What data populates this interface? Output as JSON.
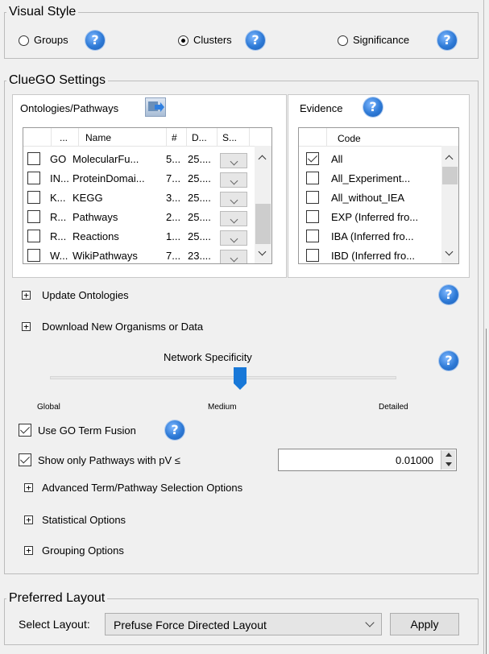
{
  "visual_style": {
    "legend": "Visual Style",
    "options": [
      {
        "label": "Groups",
        "selected": false
      },
      {
        "label": "Clusters",
        "selected": true
      },
      {
        "label": "Significance",
        "selected": false
      }
    ]
  },
  "cluego": {
    "legend": "ClueGO Settings",
    "ontologies": {
      "title": "Ontologies/Pathways",
      "columns": [
        "...",
        "Name",
        "#",
        "D...",
        "S..."
      ],
      "rows": [
        {
          "prefix": "GO",
          "name": "MolecularFu...",
          "count": "5...",
          "date": "25....",
          "checked": false
        },
        {
          "prefix": "IN...",
          "name": "ProteinDomai...",
          "count": "7...",
          "date": "25....",
          "checked": false
        },
        {
          "prefix": "K...",
          "name": "KEGG",
          "count": "3...",
          "date": "25....",
          "checked": false
        },
        {
          "prefix": "R...",
          "name": "Pathways",
          "count": "2...",
          "date": "25....",
          "checked": false
        },
        {
          "prefix": "R...",
          "name": "Reactions",
          "count": "1...",
          "date": "25....",
          "checked": false
        },
        {
          "prefix": "W...",
          "name": "WikiPathways",
          "count": "7...",
          "date": "23....",
          "checked": false
        }
      ]
    },
    "evidence": {
      "title": "Evidence",
      "column": "Code",
      "rows": [
        {
          "code": "All",
          "checked": true
        },
        {
          "code": "All_Experiment...",
          "checked": false
        },
        {
          "code": "All_without_IEA",
          "checked": false
        },
        {
          "code": "EXP (Inferred fro...",
          "checked": false
        },
        {
          "code": "IBA (Inferred fro...",
          "checked": false
        },
        {
          "code": "IBD (Inferred fro...",
          "checked": false
        }
      ]
    },
    "update_ontologies": "Update Ontologies",
    "download_new": "Download New Organisms or Data",
    "network_specificity": {
      "title": "Network Specificity",
      "labels": [
        "Global",
        "Medium",
        "Detailed"
      ],
      "selected": "Medium"
    },
    "use_go_term_fusion": {
      "label": "Use GO Term Fusion",
      "checked": true
    },
    "show_only_pathways": {
      "label": "Show only Pathways with pV ≤",
      "checked": true,
      "value": "0.01000"
    },
    "advanced_options": "Advanced Term/Pathway Selection Options",
    "statistical_options": "Statistical Options",
    "grouping_options": "Grouping Options"
  },
  "preferred_layout": {
    "legend": "Preferred Layout",
    "select_label": "Select Layout:",
    "selected_layout": "Prefuse Force Directed Layout",
    "apply": "Apply"
  },
  "help_icon_glyph": "?"
}
